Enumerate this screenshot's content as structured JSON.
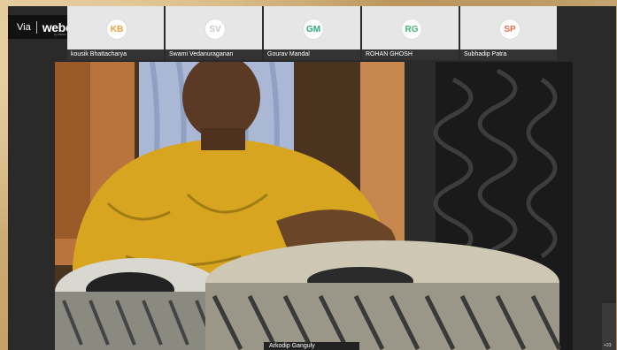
{
  "brand": {
    "via": "Via",
    "name": "webex",
    "sub": "by CISCO"
  },
  "participants": [
    {
      "initials": "KB",
      "name": "kousik Bhattacharya",
      "color": "#f0a040"
    },
    {
      "initials": "SV",
      "name": "Swami Vedanuraganan",
      "color": "#c8c8c8"
    },
    {
      "initials": "GM",
      "name": "Gourav Mandal",
      "color": "#2eab7a"
    },
    {
      "initials": "RG",
      "name": "ROHAN GHOSH",
      "color": "#44b86a"
    },
    {
      "initials": "SP",
      "name": "Subhadip Patra",
      "color": "#ee6a4f"
    }
  ],
  "active_speaker": {
    "name": "Arkodip Ganguly"
  },
  "overflow": {
    "count": "+33"
  }
}
